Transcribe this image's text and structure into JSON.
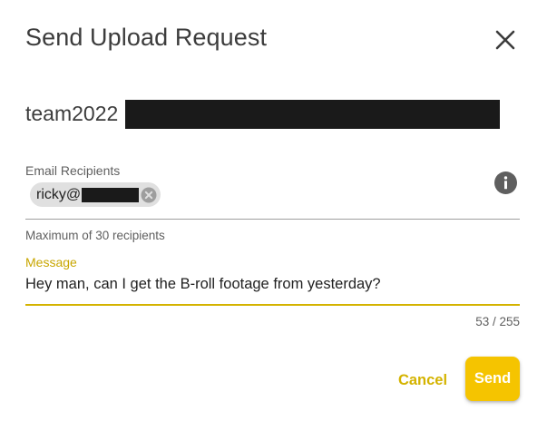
{
  "dialog": {
    "title": "Send Upload Request",
    "close_icon": "close-icon"
  },
  "folder": {
    "name": "team2022",
    "name_suffix_redacted": true
  },
  "recipients": {
    "label": "Email Recipients",
    "chips": [
      {
        "text": "ricky@",
        "redacted_suffix": true,
        "remove_icon": "cancel-circle-icon"
      }
    ],
    "info_icon": "info-icon",
    "hint": "Maximum of 30 recipients"
  },
  "message": {
    "label": "Message",
    "value": "Hey man, can I get the B-roll footage from yesterday?",
    "counter": "53 / 255"
  },
  "actions": {
    "cancel_label": "Cancel",
    "send_label": "Send"
  },
  "colors": {
    "accent": "#f5c400",
    "accent_text": "#d4b300",
    "title_text": "#3c3c3c",
    "secondary_text": "#5f5f5f",
    "chip_bg": "#e0e0e0",
    "redaction": "#1a1a1a"
  }
}
